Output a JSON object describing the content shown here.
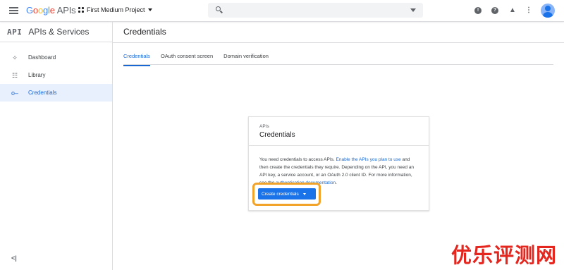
{
  "header": {
    "logo_google": [
      "G",
      "o",
      "o",
      "g",
      "l",
      "e"
    ],
    "logo_apis": "APIs",
    "project_name": "First Medium Project"
  },
  "sidebar": {
    "title": "APIs & Services",
    "logo_text": "API",
    "items": [
      {
        "label": "Dashboard",
        "icon": "dashboard-icon"
      },
      {
        "label": "Library",
        "icon": "library-icon"
      },
      {
        "label": "Credentials",
        "icon": "key-icon",
        "active": true
      }
    ],
    "collapse_label": "<|"
  },
  "main": {
    "title": "Credentials",
    "tabs": [
      {
        "label": "Credentials",
        "active": true
      },
      {
        "label": "OAuth consent screen"
      },
      {
        "label": "Domain verification"
      }
    ]
  },
  "card": {
    "eyebrow": "APIs",
    "title": "Credentials",
    "text_1": "You need credentials to access APIs. ",
    "link_1": "Enable the APIs you plan to use",
    "text_2": " and then create the credentials they require. Depending on the API, you need an API key, a service account, or an OAuth 2.0 client ID. For more information, see the ",
    "link_2": "authentication documentation",
    "text_3": ".",
    "button_label": "Create credentials"
  },
  "watermark": "优乐评测网",
  "colors": {
    "accent": "#1a73e8",
    "highlight": "#f2a32a",
    "watermark": "#e5261f"
  }
}
